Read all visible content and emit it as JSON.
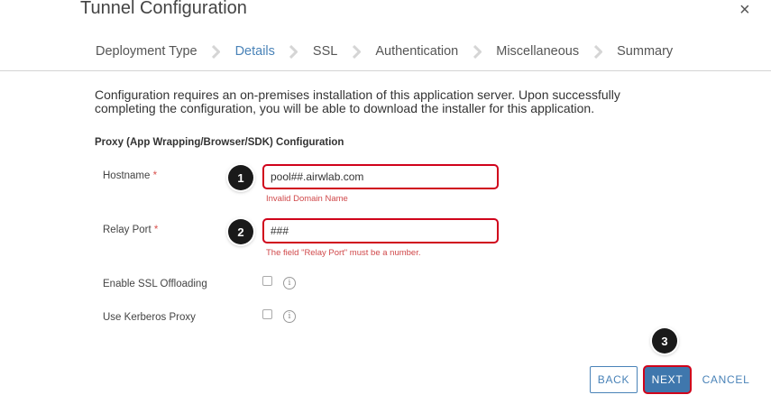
{
  "dialog": {
    "title": "Tunnel Configuration"
  },
  "steps": [
    "Deployment Type",
    "Details",
    "SSL",
    "Authentication",
    "Miscellaneous",
    "Summary"
  ],
  "intro": "Configuration requires an on-premises installation of this application server. Upon successfully completing the configuration, you will be able to download the installer for this application.",
  "section_title": "Proxy (App Wrapping/Browser/SDK) Configuration",
  "form": {
    "hostname": {
      "label": "Hostname",
      "required": "*",
      "value": "pool##.airwlab.com",
      "error": "Invalid Domain Name"
    },
    "relay_port": {
      "label": "Relay Port",
      "required": "*",
      "value": "###",
      "error": "The field \"Relay Port\" must be a number."
    },
    "ssl_offloading": {
      "label": "Enable SSL Offloading",
      "checked": false
    },
    "kerberos": {
      "label": "Use Kerberos Proxy",
      "checked": false
    },
    "info_glyph": "i"
  },
  "callouts": {
    "one": "1",
    "two": "2",
    "three": "3"
  },
  "buttons": {
    "back": "BACK",
    "next": "NEXT",
    "cancel": "CANCEL"
  },
  "icons": {
    "close": "×"
  },
  "colors": {
    "accent": "#4a83b8",
    "primary": "#3f77ad",
    "error": "#d0484a",
    "highlight": "#d0021b"
  }
}
